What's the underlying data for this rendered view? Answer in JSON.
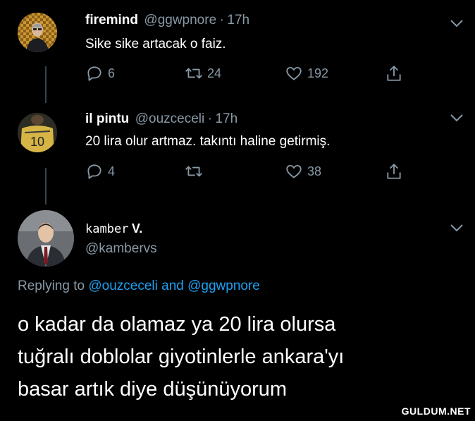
{
  "tweets": [
    {
      "name": "firemind",
      "handle": "@ggwpnore",
      "dot": "·",
      "time": "17h",
      "text": "Sike sike artacak o faiz.",
      "replies": "6",
      "retweets": "24",
      "likes": "192"
    },
    {
      "name": "il pintu",
      "handle": "@ouzceceli",
      "dot": "·",
      "time": "17h",
      "text": "20 lira olur artmaz. takıntı haline getirmiş.",
      "replies": "4",
      "retweets": "",
      "likes": "38"
    }
  ],
  "main_tweet": {
    "name_mono": "kamber",
    "name_suffix": "V.",
    "handle": "@kambervs",
    "replying_prefix": "Replying to",
    "replying_user1": "@ouzceceli",
    "replying_and": "and",
    "replying_user2": "@ggwpnore",
    "text_line1": "o kadar da olamaz ya 20 lira olursa",
    "text_line2": "tuğralı doblolar giyotinlerle ankara'yı",
    "text_line3": "basar artık diye düşünüyorum"
  },
  "watermark": "GULDUM.NET",
  "jersey_number": "10",
  "colors": {
    "background": "#000000",
    "secondary_text": "#8899a6",
    "link": "#1da1f2",
    "thread_line": "#38444d"
  },
  "icons": [
    "reply-icon",
    "retweet-icon",
    "like-icon",
    "share-icon",
    "chevron-down-icon"
  ]
}
